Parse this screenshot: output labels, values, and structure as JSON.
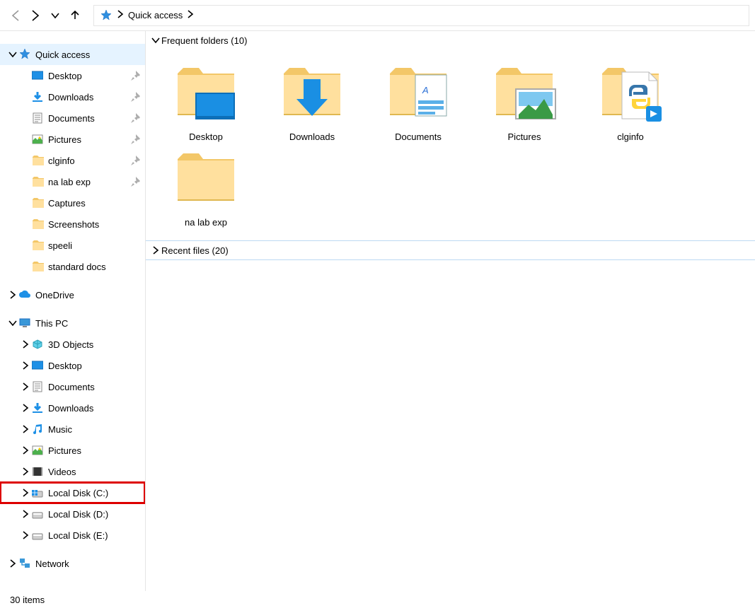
{
  "address": {
    "location": "Quick access"
  },
  "sidebar": {
    "quickAccess": {
      "label": "Quick access",
      "items": [
        {
          "label": "Desktop",
          "pinned": true
        },
        {
          "label": "Downloads",
          "pinned": true
        },
        {
          "label": "Documents",
          "pinned": true
        },
        {
          "label": "Pictures",
          "pinned": true
        },
        {
          "label": "clginfo",
          "pinned": true
        },
        {
          "label": "na lab exp",
          "pinned": true
        },
        {
          "label": "Captures",
          "pinned": false
        },
        {
          "label": "Screenshots",
          "pinned": false
        },
        {
          "label": "speeli",
          "pinned": false
        },
        {
          "label": "standard docs",
          "pinned": false
        }
      ]
    },
    "oneDrive": {
      "label": "OneDrive"
    },
    "thisPC": {
      "label": "This PC",
      "items": [
        {
          "label": "3D Objects"
        },
        {
          "label": "Desktop"
        },
        {
          "label": "Documents"
        },
        {
          "label": "Downloads"
        },
        {
          "label": "Music"
        },
        {
          "label": "Pictures"
        },
        {
          "label": "Videos"
        },
        {
          "label": "Local Disk (C:)",
          "highlight": true
        },
        {
          "label": "Local Disk (D:)"
        },
        {
          "label": "Local Disk (E:)"
        }
      ]
    },
    "network": {
      "label": "Network"
    }
  },
  "sections": {
    "frequent": {
      "title": "Frequent folders (10)"
    },
    "recent": {
      "title": "Recent files (20)"
    }
  },
  "tiles": [
    {
      "label": "Desktop",
      "variant": "desktop"
    },
    {
      "label": "Downloads",
      "variant": "downloads"
    },
    {
      "label": "Documents",
      "variant": "documents"
    },
    {
      "label": "Pictures",
      "variant": "pictures"
    },
    {
      "label": "clginfo",
      "variant": "python"
    },
    {
      "label": "na lab exp",
      "variant": "plain"
    }
  ],
  "status": {
    "text": "30 items"
  }
}
